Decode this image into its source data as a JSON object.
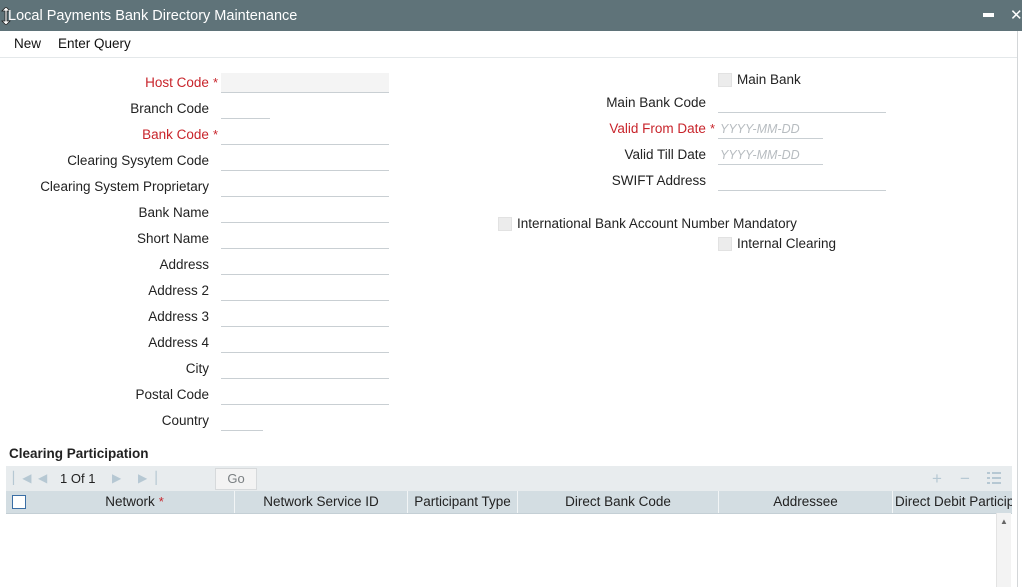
{
  "window": {
    "title": "Local Payments Bank Directory Maintenance",
    "minimize_glyph": "−",
    "close_glyph": "✕"
  },
  "menu": {
    "new": "New",
    "enter_query": "Enter Query"
  },
  "form": {
    "host_code": {
      "label": "Host Code",
      "value": ""
    },
    "branch_code": {
      "label": "Branch Code",
      "value": ""
    },
    "bank_code": {
      "label": "Bank Code",
      "value": ""
    },
    "clearing_system_code": {
      "label": "Clearing Sysytem Code",
      "value": ""
    },
    "clearing_system_proprietary": {
      "label": "Clearing System Proprietary",
      "value": ""
    },
    "bank_name": {
      "label": "Bank Name",
      "value": ""
    },
    "short_name": {
      "label": "Short Name",
      "value": ""
    },
    "address": {
      "label": "Address",
      "value": ""
    },
    "address2": {
      "label": "Address 2",
      "value": ""
    },
    "address3": {
      "label": "Address 3",
      "value": ""
    },
    "address4": {
      "label": "Address 4",
      "value": ""
    },
    "city": {
      "label": "City",
      "value": ""
    },
    "postal_code": {
      "label": "Postal Code",
      "value": ""
    },
    "country": {
      "label": "Country",
      "value": ""
    },
    "main_bank": {
      "label": "Main Bank",
      "checked": false
    },
    "main_bank_code": {
      "label": "Main Bank Code",
      "value": ""
    },
    "valid_from_date": {
      "label": "Valid From Date",
      "value": "",
      "placeholder": "YYYY-MM-DD"
    },
    "valid_till_date": {
      "label": "Valid Till Date",
      "value": "",
      "placeholder": "YYYY-MM-DD"
    },
    "swift_address": {
      "label": "SWIFT Address",
      "value": ""
    },
    "iban_mandatory": {
      "label": "International Bank Account Number Mandatory",
      "checked": false
    },
    "internal_clearing": {
      "label": "Internal Clearing",
      "checked": false
    },
    "required_marker": "*"
  },
  "clearing_participation": {
    "title": "Clearing Participation",
    "pagination": {
      "current": "1",
      "of_label": "Of",
      "total": "1",
      "go_label": "Go"
    },
    "columns": [
      "Network",
      "Network Service ID",
      "Participant Type",
      "Direct Bank Code",
      "Addressee",
      "Direct Debit Participant"
    ],
    "rows": []
  },
  "icons": {
    "first": "first-page-icon",
    "prev": "prev-page-icon",
    "next": "next-page-icon",
    "last": "last-page-icon",
    "add": "add-row-icon",
    "delete": "delete-row-icon",
    "view": "single-view-icon"
  },
  "colors": {
    "titlebar": "#5f7379",
    "required": "#c8242b",
    "grid_header": "#d3dde2",
    "toolbar": "#e8ecee"
  }
}
